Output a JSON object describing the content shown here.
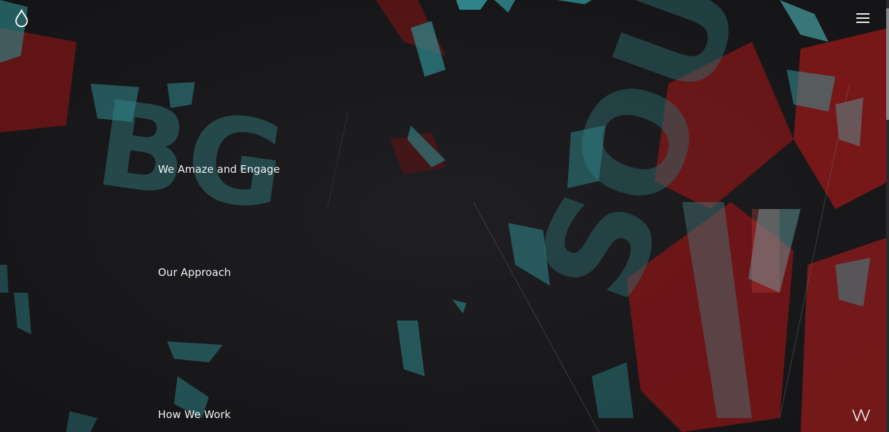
{
  "header": {
    "logo_icon": "droplet-icon",
    "menu_icon": "hamburger-menu-icon"
  },
  "nav": {
    "items": [
      {
        "label": "We Amaze and Engage"
      },
      {
        "label": "Our Approach"
      },
      {
        "label": "How We Work"
      }
    ]
  },
  "footer": {
    "sound_icon": "waveform-icon"
  },
  "colors": {
    "background": "#1a1a1d",
    "teal": "#2f8a8e",
    "red": "#8c1a1c",
    "text": "#f3f3f3"
  }
}
